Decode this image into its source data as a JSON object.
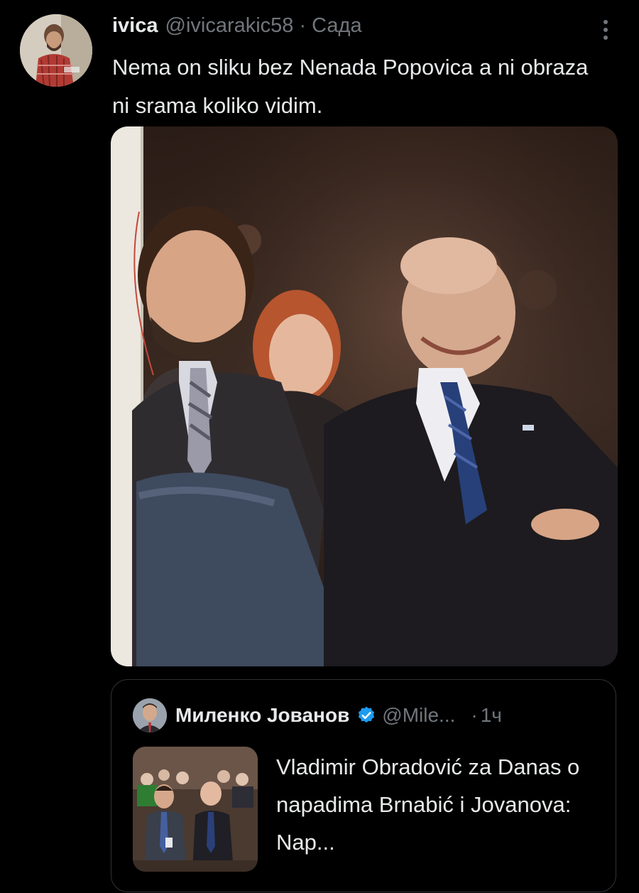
{
  "tweet": {
    "author": {
      "display_name": "ivica",
      "handle": "@ivicarakic58",
      "avatar_icon": "user-avatar"
    },
    "separator": "·",
    "time": "Сада",
    "more_icon": "more-vertical-icon",
    "text": "Nema on sliku bez Nenada Popovica a ni obraza ni srama koliko vidim.",
    "media": {
      "kind": "photo",
      "icon": "photo-image"
    }
  },
  "quote": {
    "author": {
      "display_name": "Миленко Јованов",
      "handle": "@Mile...",
      "verified_icon": "verified-badge-icon",
      "verified_color": "#1d9bf0"
    },
    "separator": "·",
    "time": "1ч",
    "text": "Vladimir Obradović za Danas o napadima Brnabić i Jovanova: Nap..."
  },
  "colors": {
    "background": "#000000",
    "primary_text": "#e7e9ea",
    "secondary_text": "#71767b",
    "border": "#2f3336",
    "accent": "#1d9bf0"
  }
}
